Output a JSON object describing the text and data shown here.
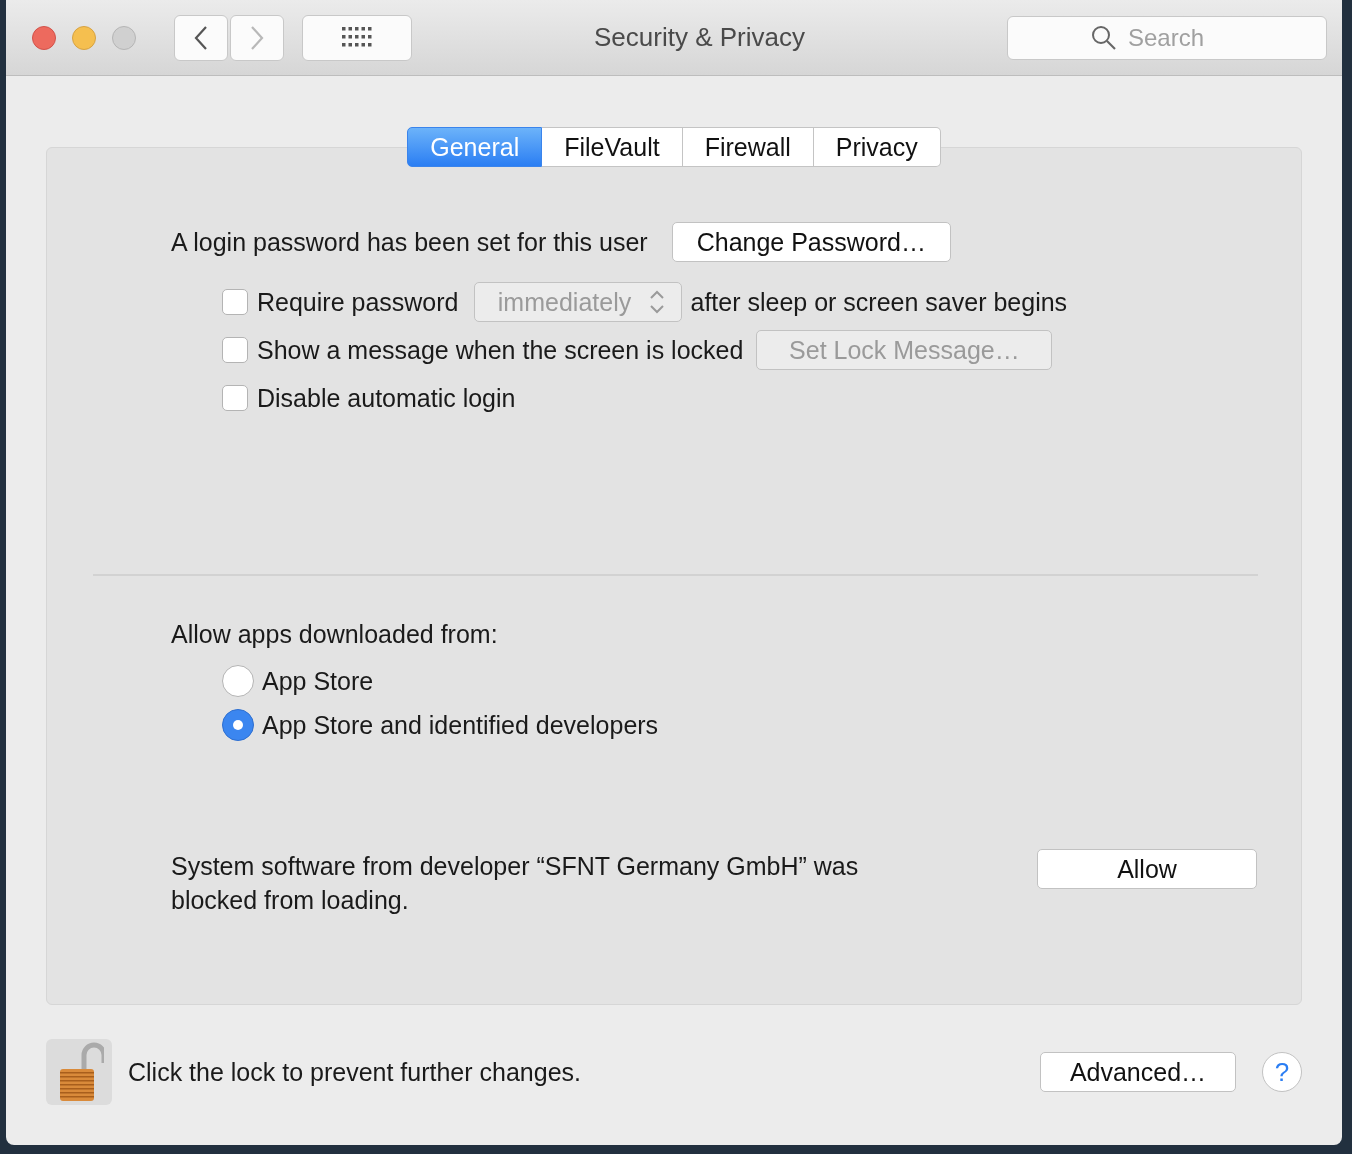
{
  "window": {
    "title": "Security & Privacy"
  },
  "toolbar": {
    "back": {
      "disabled": false
    },
    "forward": {
      "disabled": true
    },
    "search": {
      "placeholder": "Search"
    }
  },
  "tabs": [
    {
      "label": "General",
      "selected": true
    },
    {
      "label": "FileVault",
      "selected": false
    },
    {
      "label": "Firewall",
      "selected": false
    },
    {
      "label": "Privacy",
      "selected": false
    }
  ],
  "login": {
    "text": "A login password has been set for this user",
    "button": "Change Password…"
  },
  "options": [
    {
      "kind": "popup",
      "label": "Require password",
      "checked": false,
      "popup": {
        "value": "immediately",
        "disabled": true
      },
      "suffix": "after sleep or screen saver begins"
    },
    {
      "kind": "button",
      "label": "Show a message when the screen is locked",
      "checked": false,
      "button": {
        "label": "Set Lock Message…",
        "disabled": true
      }
    },
    {
      "kind": "plain",
      "label": "Disable automatic login",
      "checked": false
    }
  ],
  "allow_apps": {
    "heading": "Allow apps downloaded from:",
    "choices": [
      {
        "label": "App Store",
        "selected": false
      },
      {
        "label": "App Store and identified developers",
        "selected": true
      }
    ]
  },
  "blocked": {
    "text": "System software from developer “SFNT Germany GmbH” was blocked from loading.",
    "button": "Allow"
  },
  "footer": {
    "locked": false,
    "text": "Click the lock to prevent further changes.",
    "advanced": "Advanced…",
    "help": "?"
  }
}
